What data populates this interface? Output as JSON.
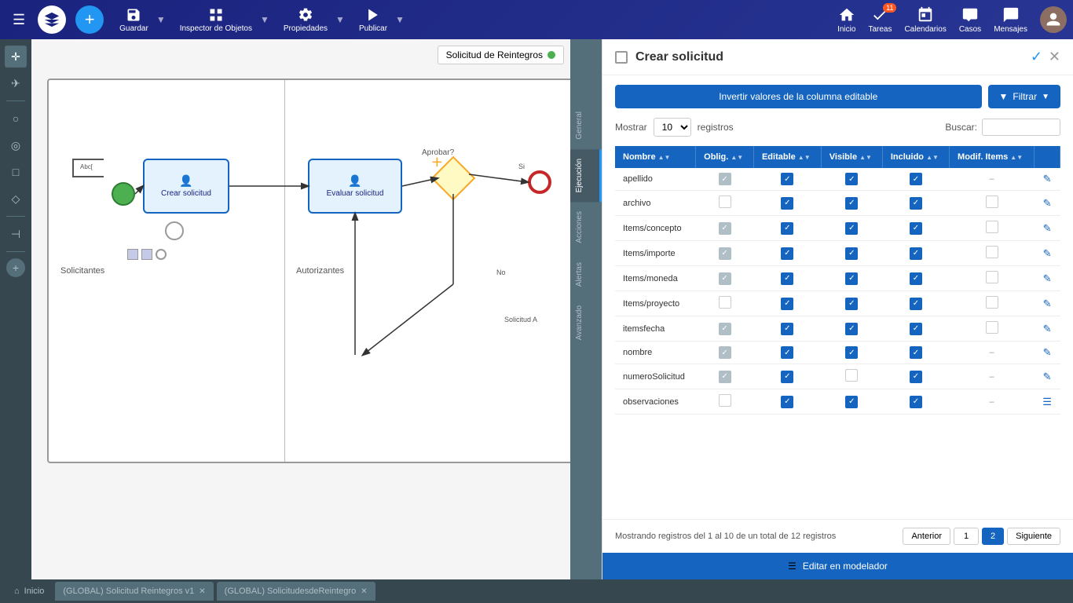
{
  "nav": {
    "add_label": "+",
    "guardar_label": "Guardar",
    "inspector_label": "Inspector de Objetos",
    "propiedades_label": "Propiedades",
    "publicar_label": "Publicar",
    "inicio_label": "Inicio",
    "tareas_label": "Tareas",
    "tareas_badge": "11",
    "calendarios_label": "Calendarios",
    "casos_label": "Casos",
    "mensajes_label": "Mensajes"
  },
  "canvas": {
    "process_title": "Solicitud de Reintegros",
    "lane_top": "",
    "lane_solicitantes": "Solicitantes",
    "lane_autorizantes": "Autorizantes",
    "task1_label": "Crear solicitud",
    "task2_label": "Evaluar solicitud",
    "gateway_label": "Aprobar?",
    "yes_label": "Si",
    "no_label": "No"
  },
  "side_tabs": [
    {
      "label": "General",
      "active": false
    },
    {
      "label": "Ejecución",
      "active": true
    },
    {
      "label": "Acciones",
      "active": false
    },
    {
      "label": "Alertas",
      "active": false
    },
    {
      "label": "Avanzado",
      "active": false
    }
  ],
  "panel": {
    "title": "Crear solicitud",
    "invert_btn": "Invertir valores de la columna editable",
    "filter_btn": "Filtrar",
    "show_label": "Mostrar",
    "show_value": "10",
    "show_suffix": "registros",
    "search_label": "Buscar:",
    "search_placeholder": "",
    "columns": [
      {
        "key": "nombre",
        "label": "Nombre",
        "sort": "▲▼"
      },
      {
        "key": "oblig",
        "label": "Oblig.",
        "sort": "▲▼"
      },
      {
        "key": "editable",
        "label": "Editable",
        "sort": "▲▼"
      },
      {
        "key": "visible",
        "label": "Visible",
        "sort": "▲▼"
      },
      {
        "key": "incluido",
        "label": "Incluido",
        "sort": "▲▼"
      },
      {
        "key": "modif_items",
        "label": "Modif. Items",
        "sort": "▲▼"
      },
      {
        "key": "actions",
        "label": ""
      }
    ],
    "rows": [
      {
        "nombre": "apellido",
        "oblig": "gray",
        "editable": "checked",
        "visible": "checked",
        "incluido": "checked",
        "modif": "dash"
      },
      {
        "nombre": "archivo",
        "oblig": "unchecked",
        "editable": "checked",
        "visible": "checked",
        "incluido": "checked",
        "modif": "unchecked"
      },
      {
        "nombre": "Items/concepto",
        "oblig": "gray",
        "editable": "checked",
        "visible": "checked",
        "incluido": "checked",
        "modif": "unchecked"
      },
      {
        "nombre": "Items/importe",
        "oblig": "gray",
        "editable": "checked",
        "visible": "checked",
        "incluido": "checked",
        "modif": "unchecked"
      },
      {
        "nombre": "Items/moneda",
        "oblig": "gray",
        "editable": "checked",
        "visible": "checked",
        "incluido": "checked",
        "modif": "unchecked"
      },
      {
        "nombre": "Items/proyecto",
        "oblig": "unchecked",
        "editable": "checked",
        "visible": "checked",
        "incluido": "checked",
        "modif": "unchecked"
      },
      {
        "nombre": "itemsfecha",
        "oblig": "gray",
        "editable": "checked",
        "visible": "checked",
        "incluido": "checked",
        "modif": "unchecked"
      },
      {
        "nombre": "nombre",
        "oblig": "gray",
        "editable": "checked",
        "visible": "checked",
        "incluido": "checked",
        "modif": "dash"
      },
      {
        "nombre": "numeroSolicitud",
        "oblig": "gray",
        "editable": "checked",
        "visible": "unchecked",
        "incluido": "checked",
        "modif": "dash"
      },
      {
        "nombre": "observaciones",
        "oblig": "unchecked",
        "editable": "checked",
        "visible": "checked",
        "incluido": "checked",
        "modif": "dash"
      }
    ],
    "pagination_info": "Mostrando registros del 1 al 10 de un total de 12 registros",
    "prev_btn": "Anterior",
    "page_current": "1",
    "page_active": "2",
    "next_btn": "Siguiente",
    "footer_btn": "Editar en modelador"
  },
  "bottom_tabs": [
    {
      "label": "Inicio",
      "icon": "home",
      "closeable": false
    },
    {
      "label": "(GLOBAL) Solicitud Reintegros v1",
      "closeable": true
    },
    {
      "label": "(GLOBAL) SolicitudesdeReintegro",
      "closeable": true
    }
  ]
}
